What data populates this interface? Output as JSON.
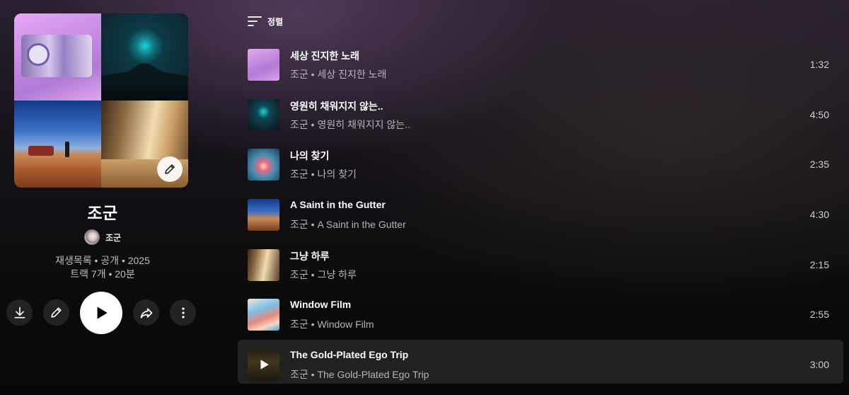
{
  "playlist": {
    "title": "조군",
    "owner": "조군",
    "meta_line1": "재생목록 • 공개 • 2025",
    "meta_line2": "트랙 7개 • 20분"
  },
  "sort": {
    "label": "정렬"
  },
  "icons": {
    "download": "download-icon",
    "edit": "pencil-icon",
    "play": "play-icon",
    "share": "share-icon",
    "more": "more-vertical-icon",
    "sort": "sort-icon"
  },
  "tracks": [
    {
      "title": "세상 진지한 노래",
      "subtitle": "조군 • 세상 진지한 노래",
      "duration": "1:32"
    },
    {
      "title": "영원히 채워지지 않는..",
      "subtitle": "조군 • 영원히 채워지지 않는..",
      "duration": "4:50"
    },
    {
      "title": "나의 찾기",
      "subtitle": "조군 • 나의 찾기",
      "duration": "2:35"
    },
    {
      "title": "A Saint in the Gutter",
      "subtitle": "조군 • A Saint in the Gutter",
      "duration": "4:30"
    },
    {
      "title": "그냥 하루",
      "subtitle": "조군 • 그냥 하루",
      "duration": "2:15"
    },
    {
      "title": "Window Film",
      "subtitle": "조군 • Window Film",
      "duration": "2:55"
    },
    {
      "title": "The Gold-Plated Ego Trip",
      "subtitle": "조군 • The Gold-Plated Ego Trip",
      "duration": "3:00"
    }
  ]
}
